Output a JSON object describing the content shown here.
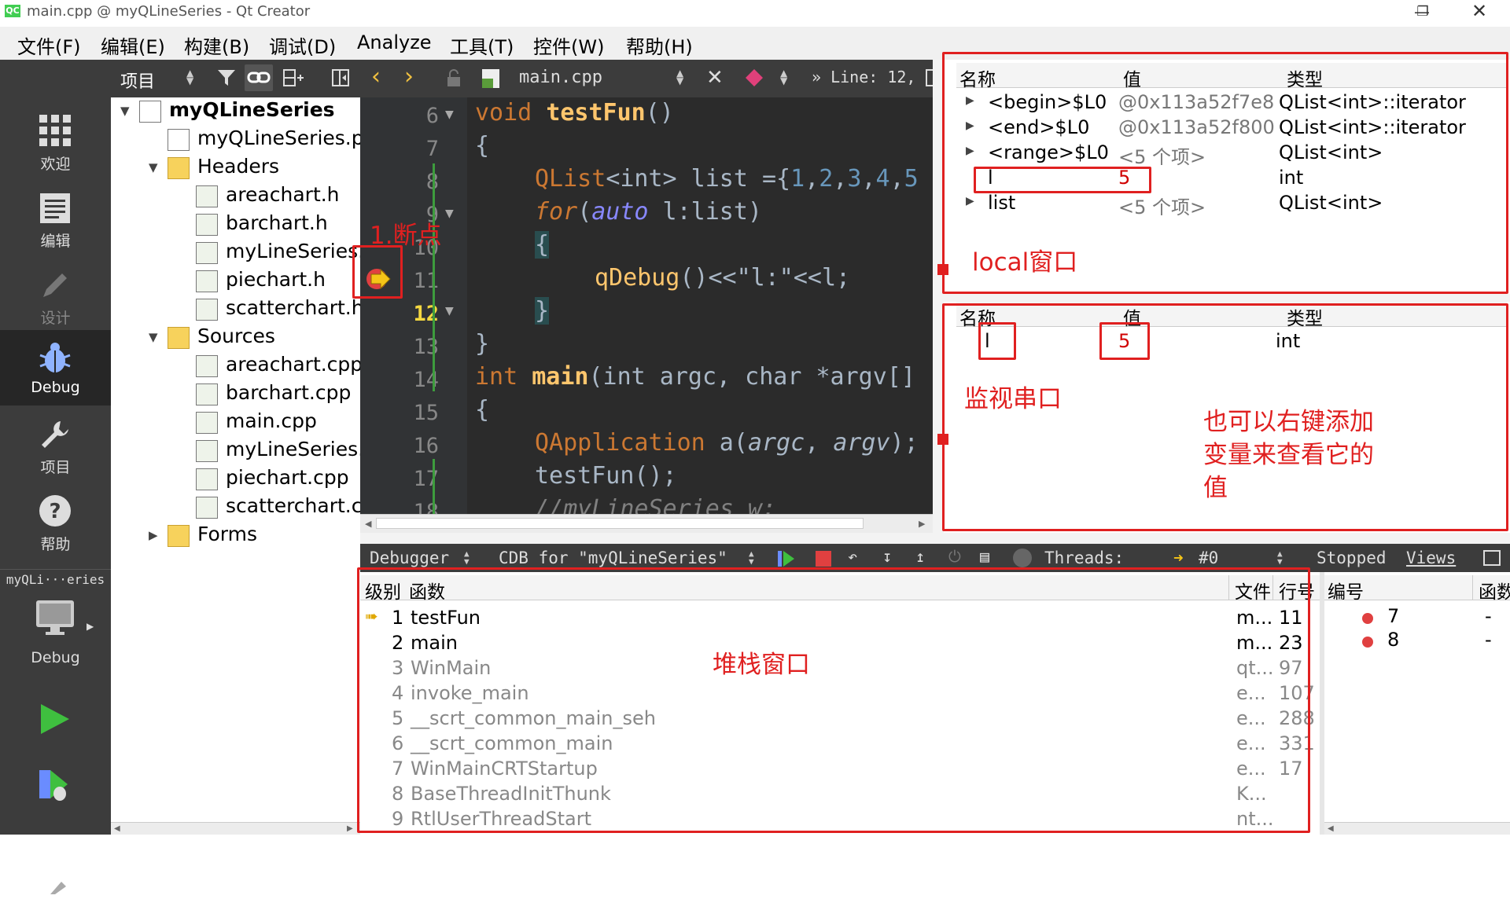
{
  "window": {
    "title": "main.cpp @ myQLineSeries - Qt Creator",
    "logo": "QC"
  },
  "menu": [
    "文件(F)",
    "编辑(E)",
    "构建(B)",
    "调试(D)",
    "Analyze",
    "工具(T)",
    "控件(W)",
    "帮助(H)"
  ],
  "modes": [
    {
      "label": "欢迎",
      "icon": "grid-icon"
    },
    {
      "label": "编辑",
      "icon": "document-icon"
    },
    {
      "label": "设计",
      "icon": "pen-icon"
    },
    {
      "label": "Debug",
      "icon": "bug-icon"
    },
    {
      "label": "项目",
      "icon": "wrench-icon"
    },
    {
      "label": "帮助",
      "icon": "help-icon"
    }
  ],
  "target": {
    "name": "myQLi···eries",
    "label": "Debug"
  },
  "project_toolbar": {
    "title": "项目"
  },
  "tree": [
    {
      "label": "myQLineSeries",
      "level": 0,
      "kind": "project",
      "expanded": true
    },
    {
      "label": "myQLineSeries.pro",
      "level": 1,
      "kind": "pro"
    },
    {
      "label": "Headers",
      "level": 1,
      "kind": "folder",
      "expanded": true
    },
    {
      "label": "areachart.h",
      "level": 2,
      "kind": "file"
    },
    {
      "label": "barchart.h",
      "level": 2,
      "kind": "file"
    },
    {
      "label": "myLineSeries.h",
      "level": 2,
      "kind": "file"
    },
    {
      "label": "piechart.h",
      "level": 2,
      "kind": "file"
    },
    {
      "label": "scatterchart.h",
      "level": 2,
      "kind": "file"
    },
    {
      "label": "Sources",
      "level": 1,
      "kind": "folder",
      "expanded": true
    },
    {
      "label": "areachart.cpp",
      "level": 2,
      "kind": "file"
    },
    {
      "label": "barchart.cpp",
      "level": 2,
      "kind": "file"
    },
    {
      "label": "main.cpp",
      "level": 2,
      "kind": "file"
    },
    {
      "label": "myLineSeries.cpp",
      "level": 2,
      "kind": "file"
    },
    {
      "label": "piechart.cpp",
      "level": 2,
      "kind": "file"
    },
    {
      "label": "scatterchart.cpp",
      "level": 2,
      "kind": "file"
    },
    {
      "label": "Forms",
      "level": 1,
      "kind": "folder",
      "expanded": false
    }
  ],
  "editor": {
    "filename": "main.cpp",
    "position": "Line: 12,",
    "lines": [
      6,
      7,
      8,
      9,
      10,
      11,
      12,
      13,
      14,
      15,
      16,
      17,
      18
    ],
    "current_line": "12",
    "code": {
      "l6a": "void ",
      "l6b": "testFun",
      "l6c": "()",
      "l7": "{",
      "l8a": "QList",
      "l8b": "<int> list ={",
      "l8c": "1",
      "l8d": ",",
      "l8e": "2",
      "l8f": ",",
      "l8g": "3",
      "l8h": ",",
      "l8i": "4",
      "l8j": ",",
      "l8k": "5",
      "l9a": "for",
      "l9b": "(",
      "l9c": "auto",
      "l9d": " l:list)",
      "l10": "{",
      "l11a": "qDebug",
      "l11b": "()<<\"l:\"<<l;",
      "l12": "}",
      "l13": "}",
      "l14a": "int ",
      "l14b": "main",
      "l14c": "(int argc, char *argv[]",
      "l15": "{",
      "l16a": "QApplication",
      "l16b": " a(",
      "l16c": "argc",
      "l16d": ", ",
      "l16e": "argv",
      "l16f": ");",
      "l17": "testFun();",
      "l18": "//myLineSeries w;"
    }
  },
  "locals": {
    "headers": [
      "名称",
      "值",
      "类型"
    ],
    "rows": [
      {
        "name": "<begin>$L0",
        "value": "@0x113a52f7e8",
        "type": "QList<int>::iterator",
        "expandable": true
      },
      {
        "name": "<end>$L0",
        "value": "@0x113a52f800",
        "type": "QList<int>::iterator",
        "expandable": true
      },
      {
        "name": "<range>$L0",
        "value": "<5 个项>",
        "type": "QList<int>",
        "expandable": true
      },
      {
        "name": "l",
        "value": "5",
        "type": "int",
        "expandable": false
      },
      {
        "name": "list",
        "value": "<5 个项>",
        "type": "QList<int>",
        "expandable": true
      }
    ]
  },
  "watch": {
    "headers": [
      "名称",
      "值",
      "类型"
    ],
    "rows": [
      {
        "name": "l",
        "value": "5",
        "type": "int"
      }
    ]
  },
  "debugger_toolbar": {
    "debugger": "Debugger",
    "engine": "CDB for \"myQLineSeries\"",
    "threads_label": "Threads:",
    "thread": "#0",
    "state": "Stopped",
    "views": "Views"
  },
  "stack": {
    "headers": {
      "level": "级别",
      "function": "函数",
      "file": "文件",
      "line": "行号"
    },
    "rows": [
      {
        "level": "1",
        "function": "testFun",
        "file": "m...",
        "line": "11",
        "current": true
      },
      {
        "level": "2",
        "function": "main",
        "file": "m...",
        "line": "23"
      },
      {
        "level": "3",
        "function": "WinMain",
        "file": "qt...",
        "line": "97"
      },
      {
        "level": "4",
        "function": "invoke_main",
        "file": "e...",
        "line": "107"
      },
      {
        "level": "5",
        "function": "__scrt_common_main_seh",
        "file": "e...",
        "line": "288"
      },
      {
        "level": "6",
        "function": "__scrt_common_main",
        "file": "e...",
        "line": "331"
      },
      {
        "level": "7",
        "function": "WinMainCRTStartup",
        "file": "e...",
        "line": "17"
      },
      {
        "level": "8",
        "function": "BaseThreadInitThunk",
        "file": "K...",
        "line": ""
      },
      {
        "level": "9",
        "function": "RtlUserThreadStart",
        "file": "nt...",
        "line": ""
      }
    ]
  },
  "breakpoints": {
    "headers": {
      "number": "编号",
      "function": "函数"
    },
    "rows": [
      {
        "number": "7",
        "function": "-"
      },
      {
        "number": "8",
        "function": "-"
      }
    ]
  },
  "annotations": {
    "breakpoint": "1.断点",
    "local": "local窗口",
    "watch": "监视串口",
    "hint": "也可以右键添加变量来查看它的值",
    "stack": "堆栈窗口"
  },
  "colors": {
    "annotation": "#e02020",
    "dark_bg": "#2b2b2b",
    "mode_bar": "#3c3c3c",
    "breakpoint": "#e04040"
  }
}
